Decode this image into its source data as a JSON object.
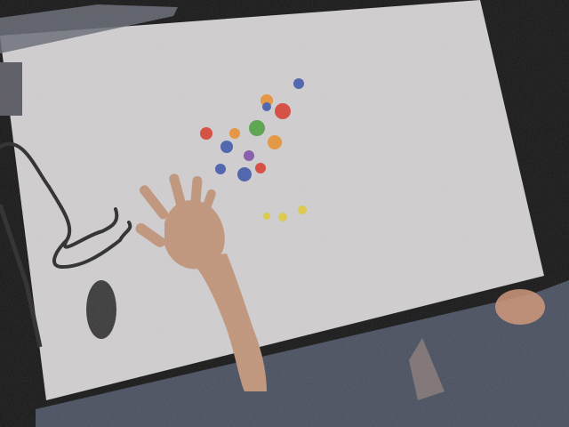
{
  "scene": {
    "background_color": "#050505",
    "table_color": "#c9c6c8",
    "floor_color": "#3a4152",
    "skin_color": "#b88a6e",
    "mouse_color": "#2a2a2a",
    "cable_color": "#1a1a1a",
    "pieces": [
      {
        "name": "blue-piece",
        "color": "#3b53a3"
      },
      {
        "name": "orange-piece",
        "color": "#e18a2c"
      },
      {
        "name": "red-piece",
        "color": "#cf3a2d"
      },
      {
        "name": "green-piece",
        "color": "#4a9a3c"
      },
      {
        "name": "yellow-piece",
        "color": "#d8c33a"
      },
      {
        "name": "purple-piece",
        "color": "#7a4aa0"
      }
    ]
  }
}
